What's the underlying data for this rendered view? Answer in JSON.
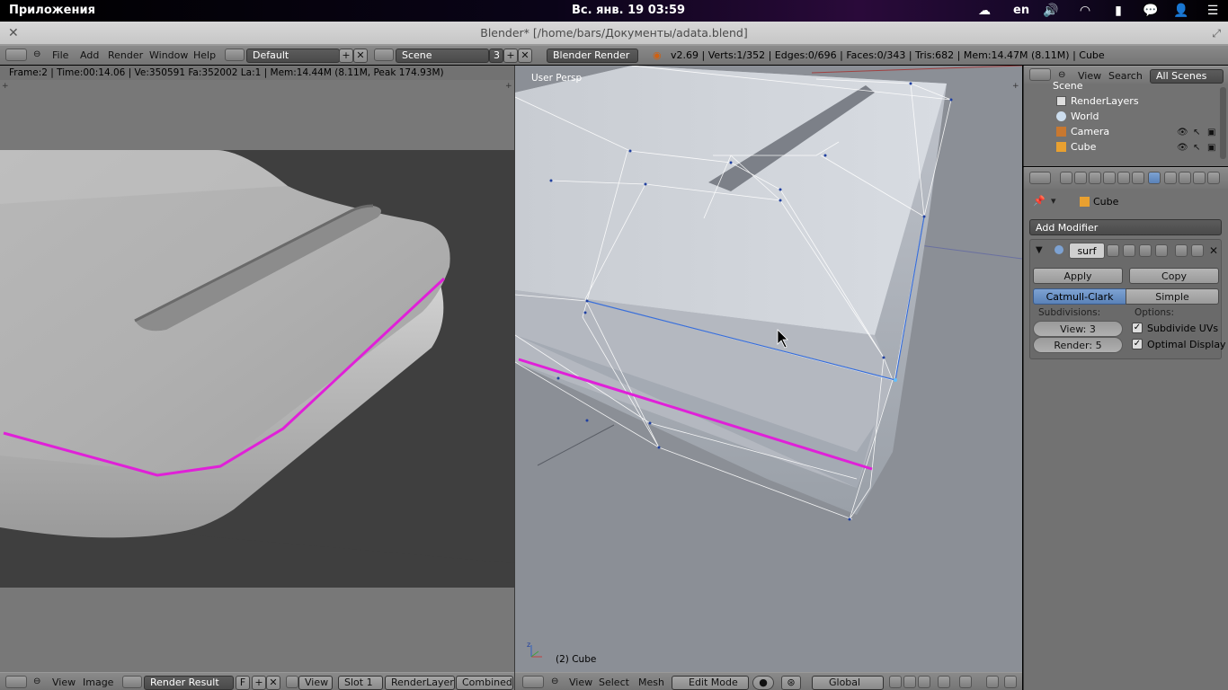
{
  "topbar": {
    "apps_label": "Приложения",
    "clock": "Вс. янв. 19 03:59",
    "lang": "en"
  },
  "window": {
    "title": "Blender* [/home/bars/Документы/adata.blend]",
    "close_glyph": "✕",
    "max_glyph": "⤢"
  },
  "main_header": {
    "menu": [
      "File",
      "Add",
      "Render",
      "Window",
      "Help"
    ],
    "layout": "Default",
    "scene": "Scene",
    "scene_users": "3",
    "engine": "Blender Render",
    "stats": "v2.69 | Verts:1/352 | Edges:0/696 | Faces:0/343 | Tris:682 | Mem:14.47M (8.11M) | Cube"
  },
  "image_editor": {
    "info": "Frame:2 | Time:00:14.06 | Ve:350591 Fa:352002 La:1 | Mem:14.44M (8.11M, Peak 174.93M)",
    "footer_menu": [
      "View",
      "Image"
    ],
    "image_name": "Render Result",
    "fake_user": "F",
    "view_label": "View",
    "slot": "Slot 1",
    "layer": "RenderLayer",
    "pass": "Combined"
  },
  "viewport": {
    "view_label": "User Persp",
    "object_label": "(2) Cube",
    "footer_menu": [
      "View",
      "Select",
      "Mesh"
    ],
    "mode": "Edit Mode",
    "orientation": "Global"
  },
  "outliner": {
    "menu": [
      "View",
      "Search"
    ],
    "filter": "All Scenes",
    "items": [
      "Scene",
      "RenderLayers",
      "World",
      "Camera",
      "Cube"
    ]
  },
  "properties": {
    "object_name": "Cube",
    "add_modifier": "Add Modifier",
    "modifier_name": "surf",
    "apply": "Apply",
    "copy": "Copy",
    "catmull": "Catmull-Clark",
    "simple": "Simple",
    "subdivisions_label": "Subdivisions:",
    "options_label": "Options:",
    "view_level": "View: 3",
    "render_level": "Render: 5",
    "subdivide_uvs": "Subdivide UVs",
    "optimal_display": "Optimal Display"
  },
  "colors": {
    "accent_magenta": "#e020d8",
    "selection_blue": "#5a82b8",
    "edge_blue": "#3a6fd8"
  }
}
